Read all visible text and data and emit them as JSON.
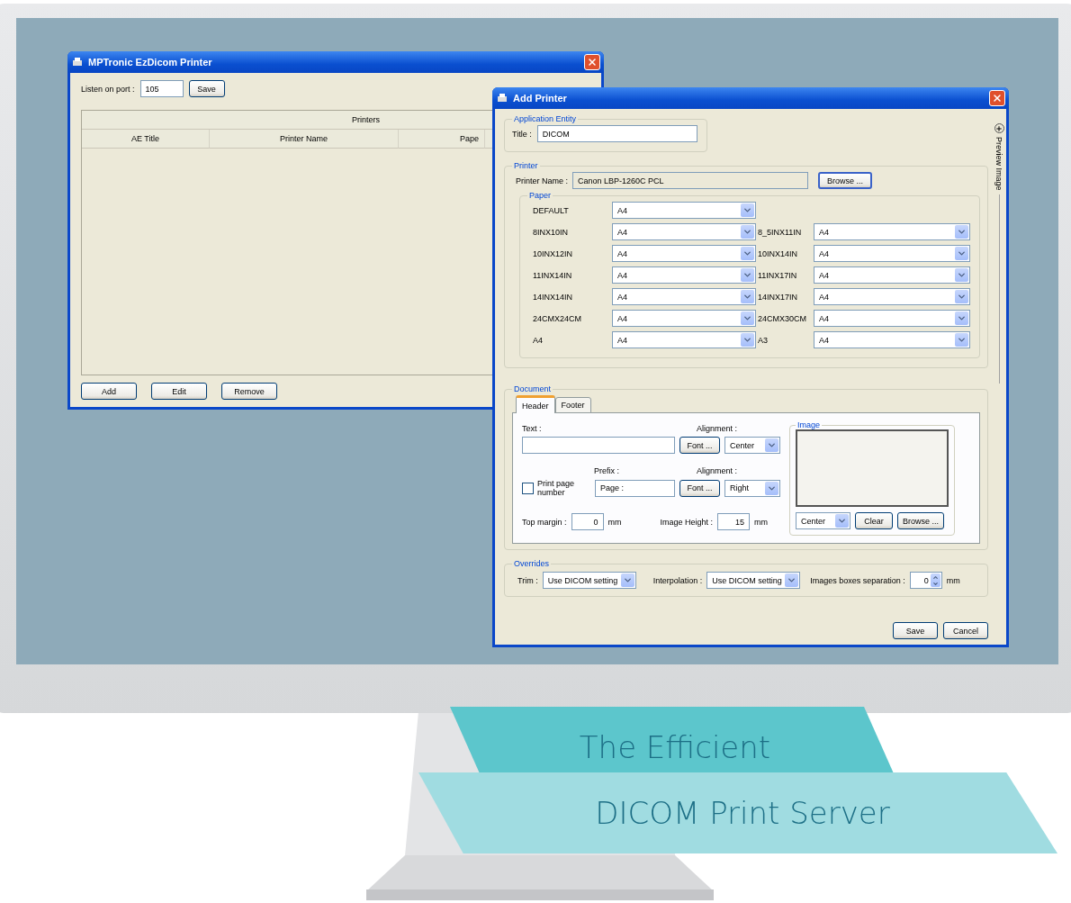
{
  "main_window": {
    "title": "MPTronic EzDicom Printer",
    "port_label": "Listen on port :",
    "port_value": "105",
    "save_button": "Save",
    "table": {
      "group_header": "Printers",
      "columns": [
        "AE Title",
        "Printer Name",
        "Pape"
      ]
    },
    "buttons": [
      "Add",
      "Edit",
      "Remove"
    ]
  },
  "dialog": {
    "title": "Add Printer",
    "application_entity": {
      "legend": "Application Entity",
      "title_label": "Title :",
      "title_value": "DICOM"
    },
    "printer": {
      "legend": "Printer",
      "name_label": "Printer Name :",
      "name_value": "Canon LBP-1260C PCL",
      "browse_button": "Browse ..."
    },
    "paper": {
      "legend": "Paper",
      "left": [
        {
          "label": "DEFAULT",
          "value": "A4"
        },
        {
          "label": "8INX10IN",
          "value": "A4"
        },
        {
          "label": "10INX12IN",
          "value": "A4"
        },
        {
          "label": "11INX14IN",
          "value": "A4"
        },
        {
          "label": "14INX14IN",
          "value": "A4"
        },
        {
          "label": "24CMX24CM",
          "value": "A4"
        },
        {
          "label": "A4",
          "value": "A4"
        }
      ],
      "right": [
        {
          "label": "8_5INX11IN",
          "value": "A4"
        },
        {
          "label": "10INX14IN",
          "value": "A4"
        },
        {
          "label": "11INX17IN",
          "value": "A4"
        },
        {
          "label": "14INX17IN",
          "value": "A4"
        },
        {
          "label": "24CMX30CM",
          "value": "A4"
        },
        {
          "label": "A3",
          "value": "A4"
        }
      ]
    },
    "document": {
      "legend": "Document",
      "tabs": [
        {
          "label": "Header",
          "selected": true
        },
        {
          "label": "Footer",
          "selected": false
        }
      ],
      "text_label": "Text :",
      "font_button": "Font ...",
      "alignment_label": "Alignment :",
      "text_alignment": "Center",
      "print_page_number": {
        "label": "Print page number",
        "checked": false
      },
      "prefix_label": "Prefix :",
      "prefix_value": "Page :",
      "prefix_font_button": "Font ...",
      "prefix_alignment_label": "Alignment :",
      "prefix_alignment": "Right",
      "top_margin_label": "Top margin :",
      "top_margin_value": "0",
      "top_margin_unit": "mm",
      "image_height_label": "Image Height :",
      "image_height_value": "15",
      "image_height_unit": "mm",
      "image": {
        "legend": "Image",
        "alignment": "Center",
        "clear_button": "Clear",
        "browse_button": "Browse ..."
      }
    },
    "overrides": {
      "legend": "Overrides",
      "trim_label": "Trim :",
      "trim_value": "Use DICOM setting",
      "interpolation_label": "Interpolation :",
      "interpolation_value": "Use DICOM setting",
      "separation_label": "Images boxes separation :",
      "separation_value": "0",
      "separation_unit": "mm"
    },
    "buttons": [
      "Save",
      "Cancel"
    ],
    "side_panel": {
      "label": "Preview Image"
    }
  },
  "banner": {
    "line_1": "The Efficient",
    "line_2": "DICOM Print Server"
  }
}
